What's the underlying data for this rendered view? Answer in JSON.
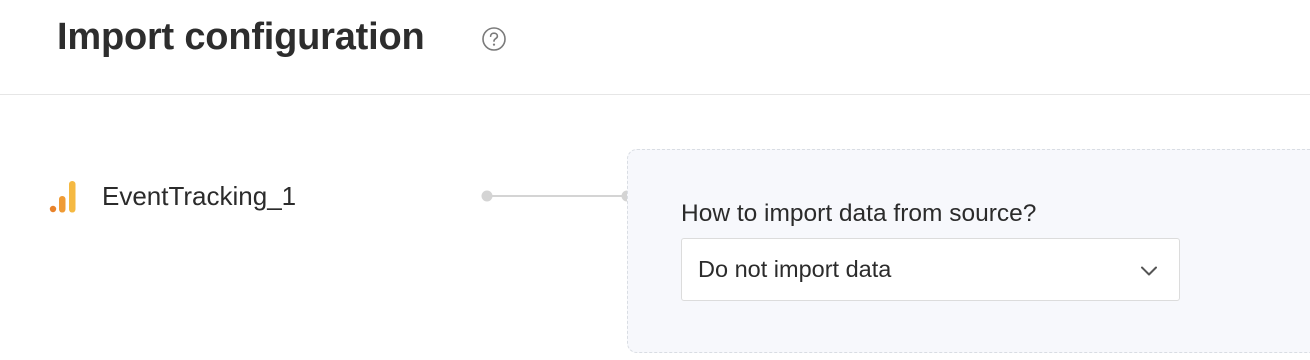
{
  "header": {
    "title": "Import configuration",
    "help_icon": "question-circle-icon"
  },
  "source": {
    "icon": "analytics-bars-icon",
    "name": "EventTracking_1",
    "icon_colors": [
      "#e8822a",
      "#f0a13a",
      "#f5b942"
    ]
  },
  "config": {
    "question": "How to import data from source?",
    "import_mode": {
      "selected": "Do not import data",
      "icon": "chevron-down-icon"
    }
  },
  "colors": {
    "panel_bg": "#f7f8fc",
    "panel_border": "#d9dde3",
    "connector": "#d4d4d4"
  }
}
